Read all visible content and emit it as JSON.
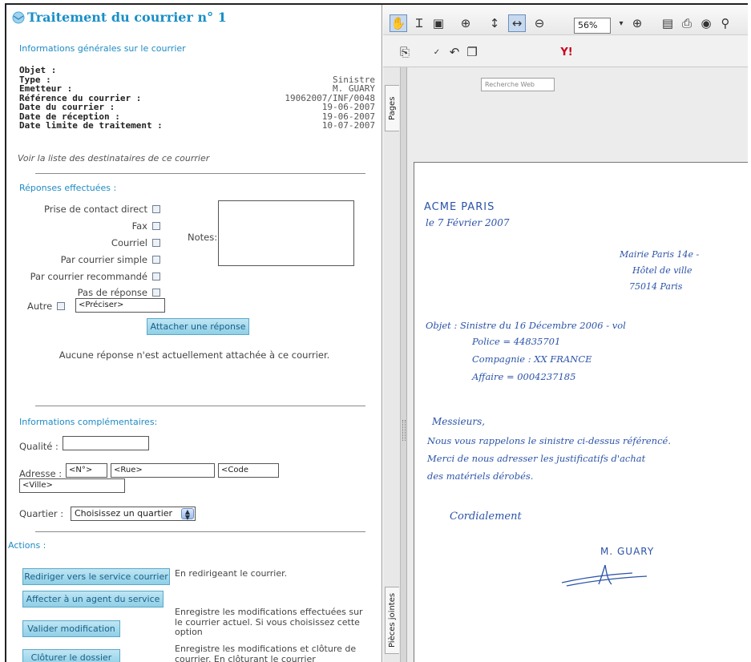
{
  "header": {
    "title": "Traitement du courrier n° 1"
  },
  "general": {
    "section_title": "Informations générales sur le courrier",
    "fields": [
      {
        "label": "Objet :",
        "value": ""
      },
      {
        "label": "Type :",
        "value": "Sinistre"
      },
      {
        "label": "Emetteur :",
        "value": "M. GUARY"
      },
      {
        "label": "Référence du courrier :",
        "value": "19062007/INF/0048"
      },
      {
        "label": "Date du courrier :",
        "value": "19-06-2007"
      },
      {
        "label": "Date de réception :",
        "value": "19-06-2007"
      },
      {
        "label": "Date limite de traitement :",
        "value": "10-07-2007"
      }
    ],
    "recipients_link": "Voir la liste des destinataires de ce courrier"
  },
  "responses": {
    "section_title": "Réponses effectuées :",
    "options": [
      "Prise de contact direct",
      "Fax",
      "Courriel",
      "Par courrier simple",
      "Par courrier recommandé",
      "Pas de réponse"
    ],
    "other_label": "Autre",
    "other_placeholder": "<Préciser>",
    "notes_label": "Notes:",
    "attach_button": "Attacher une réponse",
    "no_response_text": "Aucune réponse n'est actuellement attachée à ce courrier."
  },
  "complementary": {
    "section_title": "Informations complémentaires:",
    "qualite_label": "Qualité :",
    "adresse_label": "Adresse :",
    "num_placeholder": "<N°>",
    "rue_placeholder": "<Rue>",
    "code_placeholder": "<Code",
    "ville_placeholder": "<Ville>",
    "quartier_label": "Quartier :",
    "quartier_value": "Choisissez un quartier"
  },
  "actions": {
    "section_title": "Actions :",
    "redirect_button": "Rediriger vers le service courrier",
    "redirect_desc": "En redirigeant le courrier.",
    "assign_button": "Affecter à un agent du service",
    "validate_button": "Valider modification",
    "validate_desc": [
      "Enregistre les modifications effectuées sur",
      "le courrier actuel. Si vous choisissez cette",
      "option"
    ],
    "close_button": "Clôturer le dossier",
    "close_desc": [
      "Enregistre les modifications et clôture de",
      "courrier. En clôturant le courrier"
    ]
  },
  "viewer": {
    "zoom": "56%",
    "search_placeholder": "Recherche Web",
    "tab_pages": "Pages",
    "tab_attachments": "Pièces jointes",
    "letter": {
      "sender": "ACME PARIS",
      "date": "le 7 Février 2007",
      "recipient": [
        "Mairie Paris 14e -",
        "Hôtel de ville",
        "75014 Paris"
      ],
      "subject": [
        "Objet : Sinistre du 16 Décembre 2006 - vol",
        "Police = 44835701",
        "Compagnie : XX FRANCE",
        "Affaire = 0004237185"
      ],
      "greeting": "Messieurs,",
      "body": [
        "Nous vous rappelons le sinistre ci-dessus référencé.",
        "Merci de nous adresser les justificatifs d'achat",
        "des matériels dérobés."
      ],
      "closing": "Cordialement",
      "signature": "M. GUARY"
    }
  },
  "colors": {
    "accent": "#1e8bc3",
    "button": "#8fcfe7",
    "ink": "#2b53a8"
  }
}
